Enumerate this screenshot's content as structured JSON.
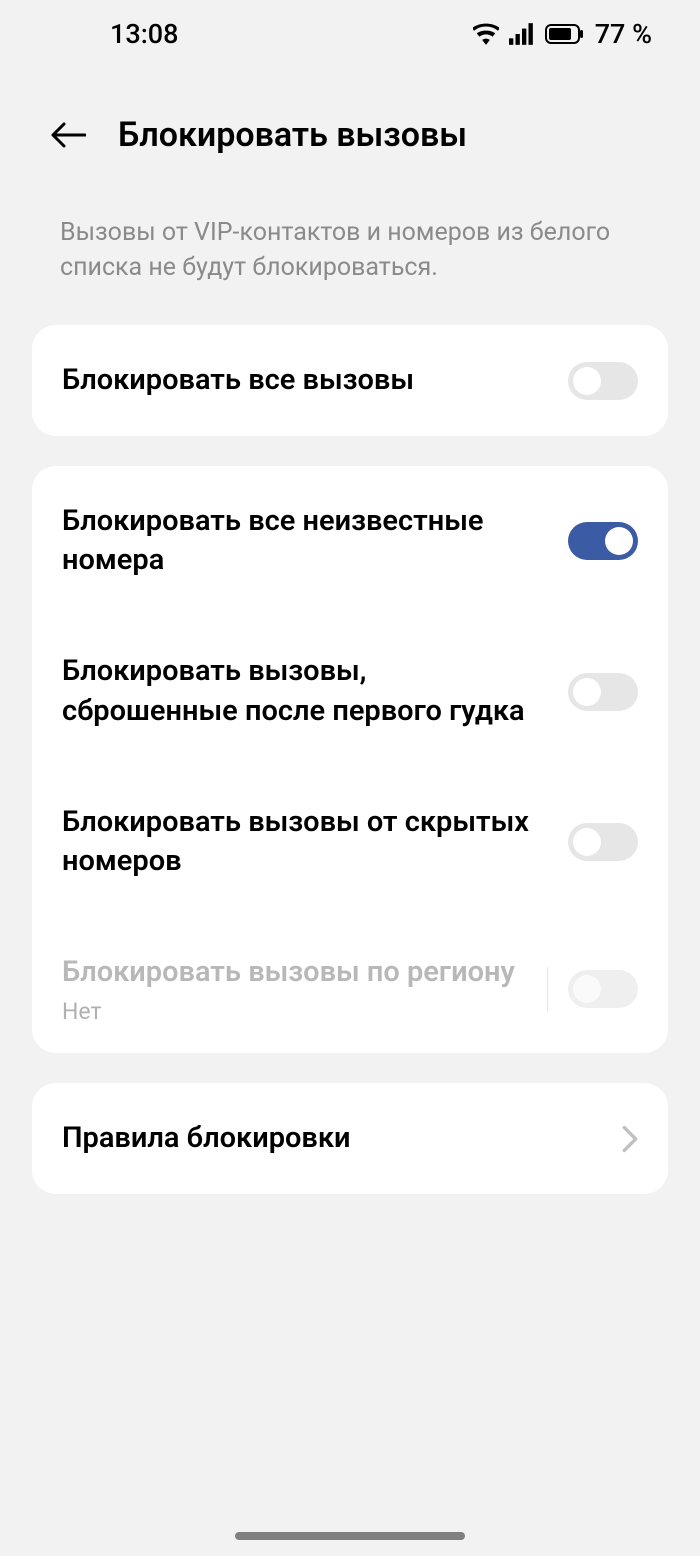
{
  "status_bar": {
    "time": "13:08",
    "battery_percent": "77 %"
  },
  "header": {
    "title": "Блокировать вызовы"
  },
  "description": "Вызовы от VIP-контактов и номеров из белого списка не будут блокироваться.",
  "settings": {
    "block_all": {
      "label": "Блокировать все вызовы",
      "enabled": false
    },
    "block_unknown": {
      "label": "Блокировать все неизвестные номера",
      "enabled": true
    },
    "block_one_ring": {
      "label": "Блокировать вызовы, сброшенные после первого гудка",
      "enabled": false
    },
    "block_hidden": {
      "label": "Блокировать вызовы от скрытых номеров",
      "enabled": false
    },
    "block_region": {
      "label": "Блокировать вызовы по региону",
      "value": "Нет",
      "enabled": false,
      "disabled": true
    }
  },
  "rules": {
    "label": "Правила блокировки"
  },
  "colors": {
    "accent": "#3b5ba5",
    "card_bg": "#ffffff",
    "page_bg": "#f2f2f2",
    "text_secondary": "#8a8a8a",
    "text_disabled": "#b8b8b8"
  }
}
